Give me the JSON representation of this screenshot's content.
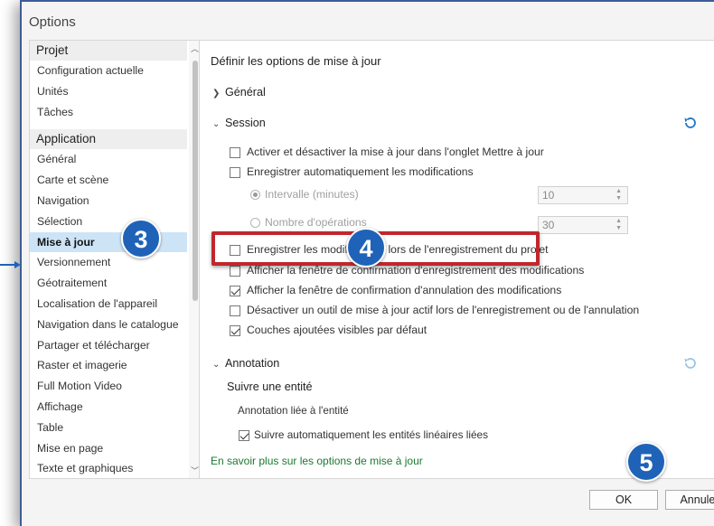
{
  "window": {
    "title": "Options"
  },
  "nav": {
    "groups": [
      {
        "label": "Projet",
        "items": [
          "Configuration actuelle",
          "Unités",
          "Tâches"
        ]
      },
      {
        "label": "Application",
        "items": [
          "Général",
          "Carte et scène",
          "Navigation",
          "Sélection",
          "Mise à jour",
          "Versionnement",
          "Géotraitement",
          "Localisation de l'appareil",
          "Navigation dans le catalogue",
          "Partager et télécharger",
          "Raster et imagerie",
          "Full Motion Video",
          "Affichage",
          "Table",
          "Mise en page",
          "Texte et graphiques"
        ]
      }
    ],
    "selected": "Mise à jour"
  },
  "panel": {
    "title": "Définir les options de mise à jour",
    "general": {
      "label": "Général"
    },
    "session": {
      "label": "Session",
      "opt1": "Activer et désactiver la mise à jour dans l'onglet Mettre à jour",
      "opt2": "Enregistrer automatiquement les modifications",
      "radio1": "Intervalle (minutes)",
      "radio1_value": "10",
      "radio2": "Nombre d'opérations",
      "radio2_value": "30",
      "opt3": "Enregistrer les modifications lors de l'enregistrement du projet",
      "opt4": "Afficher la fenêtre de confirmation d'enregistrement des modifications",
      "opt5": "Afficher la fenêtre de confirmation d'annulation des modifications",
      "opt6": "Désactiver un outil de mise à jour actif lors de l'enregistrement ou de l'annulation",
      "opt7": "Couches ajoutées visibles par défaut"
    },
    "annotation": {
      "label": "Annotation",
      "sub": "Suivre une entité",
      "sub2": "Annotation liée à l'entité",
      "opt": "Suivre automatiquement les entités linéaires liées"
    },
    "learn_more": "En savoir plus sur les options de mise à jour"
  },
  "footer": {
    "ok": "OK",
    "cancel": "Annuler"
  },
  "callouts": {
    "b3": "3",
    "b4": "4",
    "b5": "5"
  },
  "colors": {
    "accent": "#1f63b8",
    "highlight": "#c0272d",
    "selection": "#cde4f7",
    "link": "#1a7a30"
  }
}
